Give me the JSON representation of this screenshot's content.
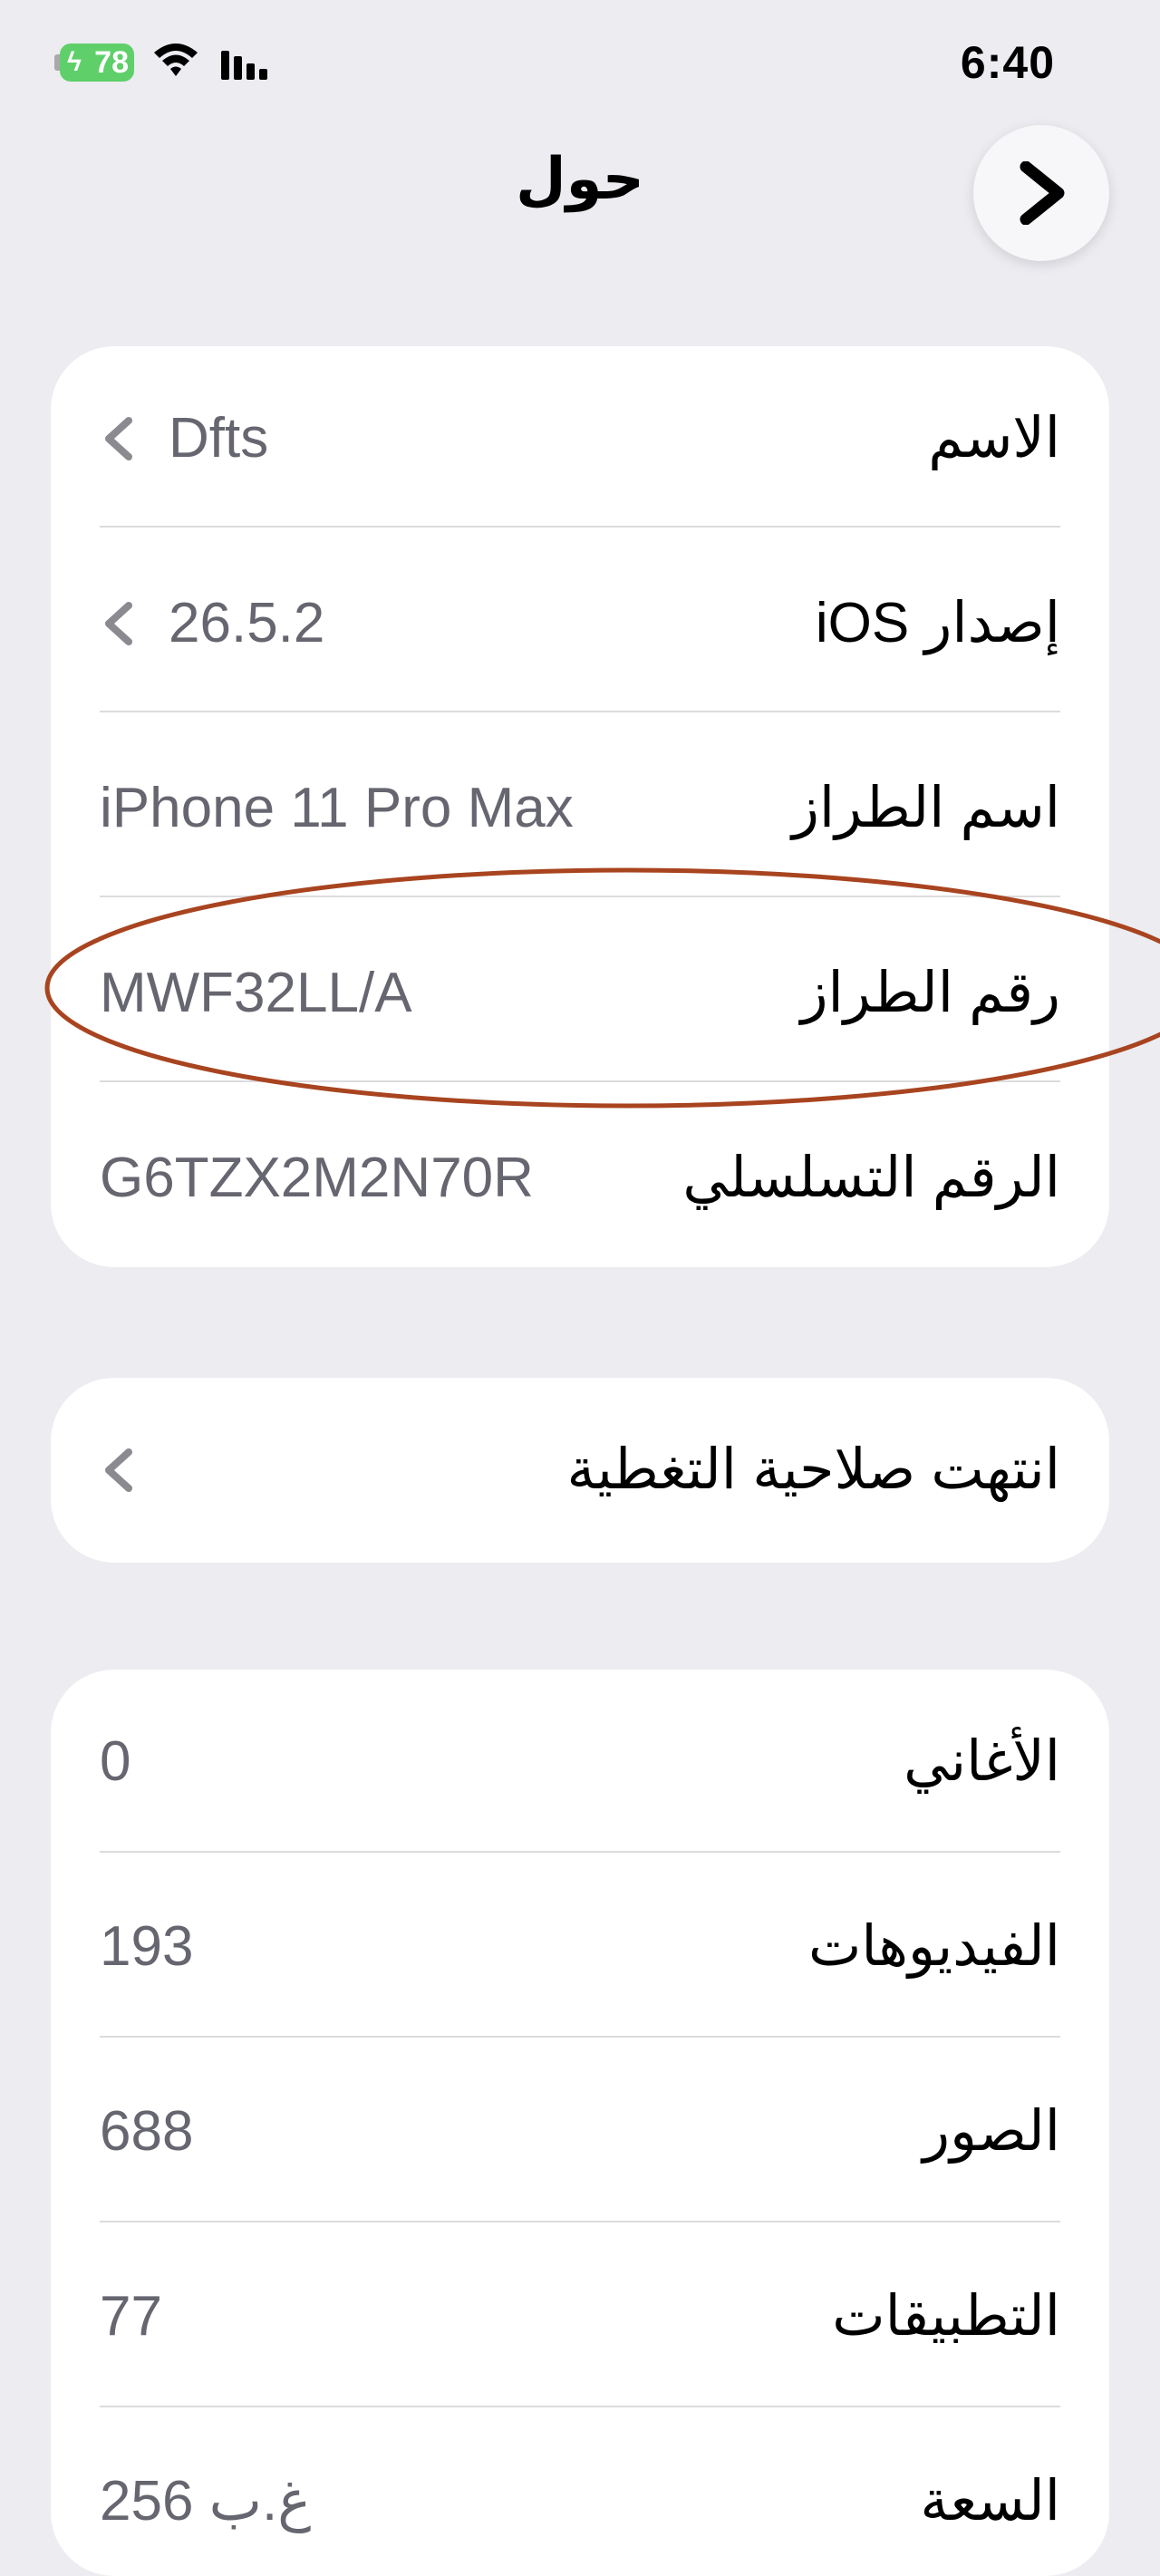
{
  "status_bar": {
    "battery_level": "78",
    "time": "6:40"
  },
  "nav": {
    "title": "حول",
    "back_icon": "chevron-right-icon"
  },
  "device_info": [
    {
      "label": "الاسم",
      "value": "Dfts",
      "chevron": true
    },
    {
      "label": "إصدار iOS",
      "value": "26.5.2",
      "chevron": true
    },
    {
      "label": "اسم الطراز",
      "value": "iPhone 11 Pro Max",
      "chevron": false
    },
    {
      "label": "رقم الطراز",
      "value": "MWF32LL/A",
      "chevron": false
    },
    {
      "label": "الرقم التسلسلي",
      "value": "G6TZX2M2N70R",
      "chevron": false
    }
  ],
  "coverage": {
    "label": "انتهت صلاحية التغطية"
  },
  "media_counts": [
    {
      "label": "الأغاني",
      "value": "0"
    },
    {
      "label": "الفيديوهات",
      "value": "193"
    },
    {
      "label": "الصور",
      "value": "688"
    },
    {
      "label": "التطبيقات",
      "value": "77"
    },
    {
      "label": "السعة",
      "value": "256 غ.ب"
    }
  ],
  "colors": {
    "background": "#ececf1",
    "card": "#ffffff",
    "value_text": "#666670",
    "annotation": "#a8441f",
    "battery": "#5fcf6a"
  }
}
